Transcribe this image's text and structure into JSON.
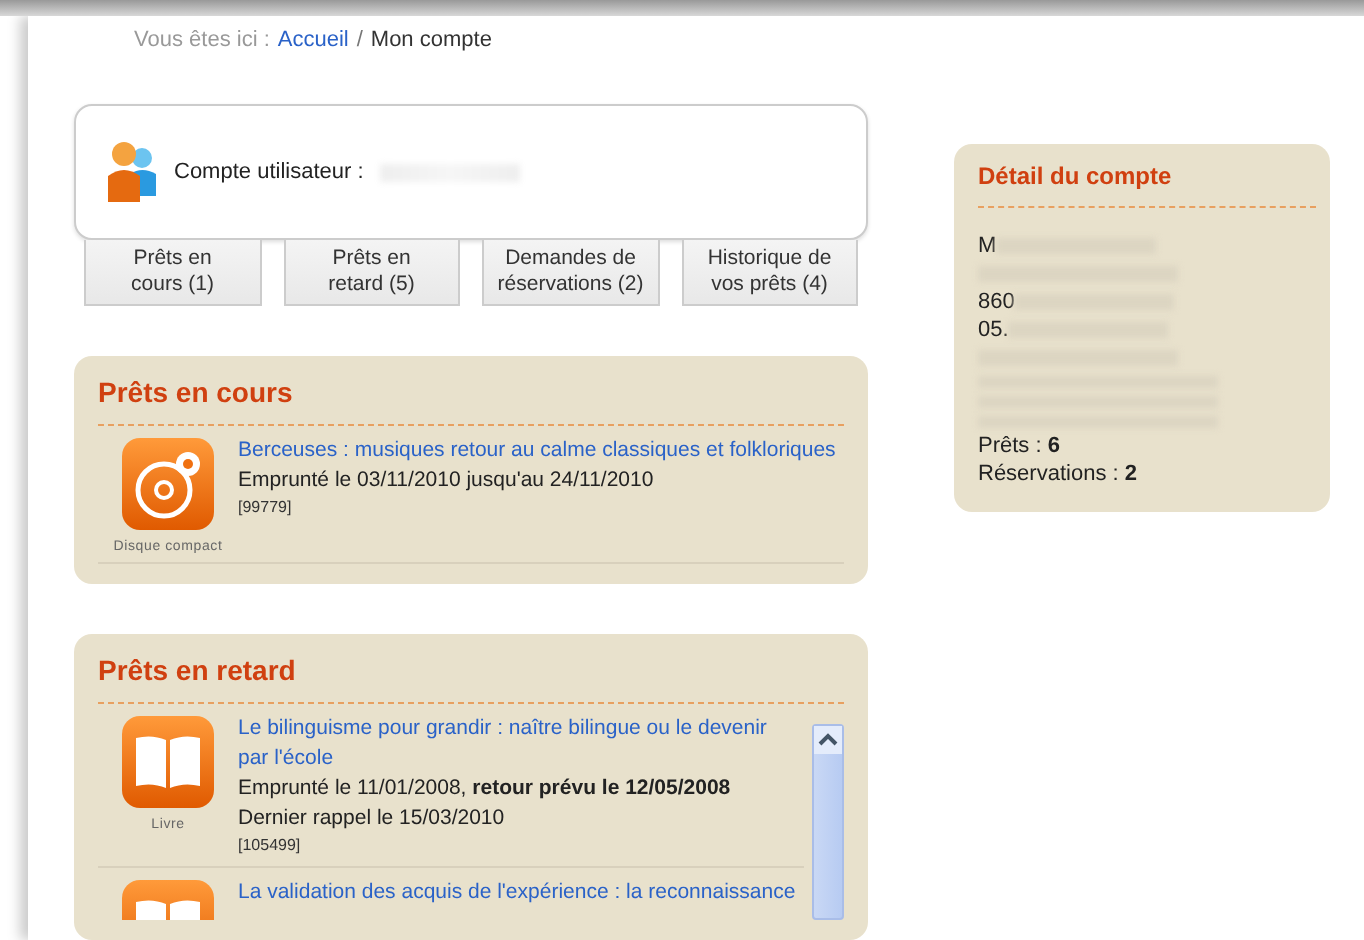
{
  "breadcrumb": {
    "label": "Vous êtes ici :",
    "trail": [
      {
        "kind": "link",
        "text": "Accueil"
      },
      {
        "kind": "separator",
        "text": "/"
      },
      {
        "kind": "current",
        "text": "Mon compte"
      }
    ]
  },
  "account": {
    "label": "Compte utilisateur :"
  },
  "tabs": [
    {
      "label": "Prêts en cours (1)"
    },
    {
      "label": "Prêts en retard (5)"
    },
    {
      "label": "Demandes de réservations (2)"
    },
    {
      "label": "Historique de vos prêts (4)"
    }
  ],
  "loan_sections": [
    {
      "title": "Prêts en cours",
      "scrollable": false,
      "items": [
        {
          "kind": "cd",
          "type_label": "Disque compact",
          "title": "Berceuses : musiques retour au calme classiques et folkloriques",
          "lines": [
            "Emprunté le 03/11/2010 jusqu'au 24/11/2010"
          ],
          "ref": "[99779]"
        }
      ]
    },
    {
      "title": "Prêts en retard",
      "scrollable": true,
      "items": [
        {
          "kind": "book",
          "type_label": "Livre",
          "title": "Le bilinguisme pour grandir : naître bilingue ou le devenir par l'école",
          "lines": [
            "Emprunté le 11/01/2008, **retour prévu le 12/05/2008**",
            "Dernier rappel le 15/03/2010"
          ],
          "ref": "[105499]"
        },
        {
          "kind": "book",
          "title": "La validation des acquis de l'expérience : la reconnaissance"
        }
      ]
    }
  ],
  "detail": {
    "title": "Détail du compte",
    "lines": [
      {
        "kind": "partial",
        "text": "M"
      },
      {
        "kind": "redacted"
      },
      {
        "kind": "partial",
        "text": "860"
      },
      {
        "kind": "partial",
        "text": "05."
      },
      {
        "kind": "redacted"
      },
      {
        "kind": "redacted_small"
      },
      {
        "kind": "redacted_small"
      },
      {
        "kind": "redacted_small"
      },
      {
        "kind": "text",
        "text": "Prêts : **6**"
      },
      {
        "kind": "text",
        "text": "Réservations : **2**"
      }
    ]
  }
}
